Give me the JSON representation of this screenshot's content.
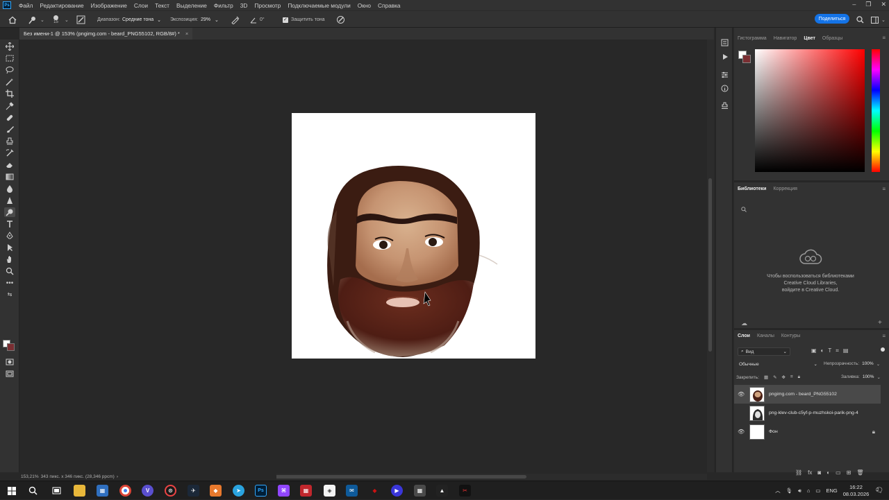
{
  "menubar": {
    "items": [
      "Файл",
      "Редактирование",
      "Изображение",
      "Слои",
      "Текст",
      "Выделение",
      "Фильтр",
      "3D",
      "Просмотр",
      "Подключаемые модули",
      "Окно",
      "Справка"
    ]
  },
  "options": {
    "brush_size": "15",
    "range_label": "Диапазон:",
    "range_value": "Средние тона",
    "exposure_label": "Экспозиция:",
    "exposure_value": "29%",
    "angle_value": "0°",
    "protect_tones_label": "Защитить тона",
    "share_label": "Поделиться"
  },
  "document": {
    "tab_title": "Без имени-1 @ 153% (pngimg.com - beard_PNG55102, RGB/8#) *",
    "close_glyph": "×"
  },
  "status": {
    "zoom": "153,21%",
    "info": "343 пикс. x 346 пикс. (28,346 ppcm)",
    "arrow": "›"
  },
  "panels": {
    "color_tabs": [
      "Гистограмма",
      "Навигатор",
      "Цвет",
      "Образцы"
    ],
    "color_tab_active": "Цвет",
    "fg_color": "#ffffff",
    "bg_color": "#7a2e32",
    "libs_tabs": [
      "Библиотеки",
      "Коррекция"
    ],
    "libs_message": [
      "Чтобы воспользоваться библиотеками",
      "Creative Cloud Libraries,",
      "войдите в Creative Cloud."
    ],
    "layers_tabs": [
      "Слои",
      "Каналы",
      "Контуры"
    ],
    "kind_label": "Вид",
    "blend_mode": "Обычные",
    "opacity_label": "Непрозрачность:",
    "opacity_value": "100%",
    "lock_label": "Закрепить:",
    "fill_label": "Заливка:",
    "fill_value": "100%",
    "layers": [
      {
        "name": "pngimg.com - beard_PNG55102",
        "visible": true,
        "selected": true
      },
      {
        "name": "png-klev-club-c5yf-p-muzhskoi-parik-png-4",
        "visible": false,
        "selected": false
      },
      {
        "name": "Фон",
        "visible": true,
        "selected": false,
        "locked": true
      }
    ]
  },
  "taskbar": {
    "lang": "ENG",
    "time": "16:22",
    "date": "08.03.2026",
    "notif_count": "2"
  }
}
